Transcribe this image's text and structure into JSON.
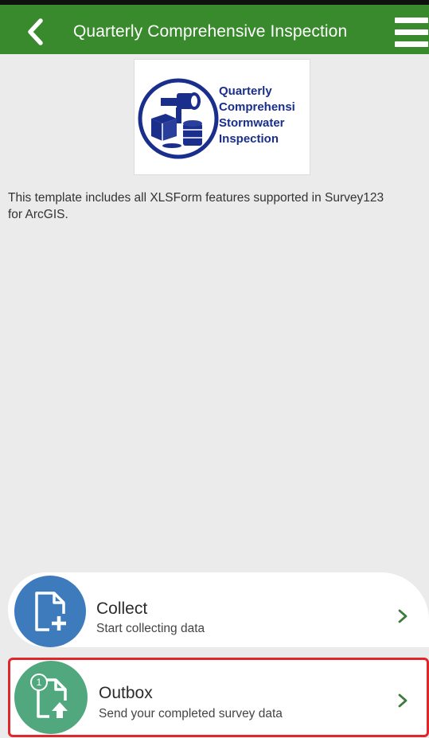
{
  "header": {
    "title": "Quarterly Comprehensive Inspection",
    "back_icon": "chevron-left-icon",
    "menu_icon": "hamburger-menu-icon",
    "color": "#398a2d"
  },
  "logo": {
    "lines": [
      "Quarterly",
      "Comprehensi",
      "Stormwater",
      "Inspection"
    ],
    "color": "#1a2e8c"
  },
  "description": "This template includes all XLSForm features supported in Survey123 for ArcGIS.",
  "actions": [
    {
      "title": "Collect",
      "subtitle": "Start collecting data",
      "icon": "add-document-icon",
      "color": "#3e7bbd"
    },
    {
      "title": "Outbox",
      "subtitle": "Send your completed survey data",
      "icon": "upload-document-icon",
      "badge": "1",
      "color": "#52a87e",
      "highlight_color": "#e0262b"
    }
  ]
}
